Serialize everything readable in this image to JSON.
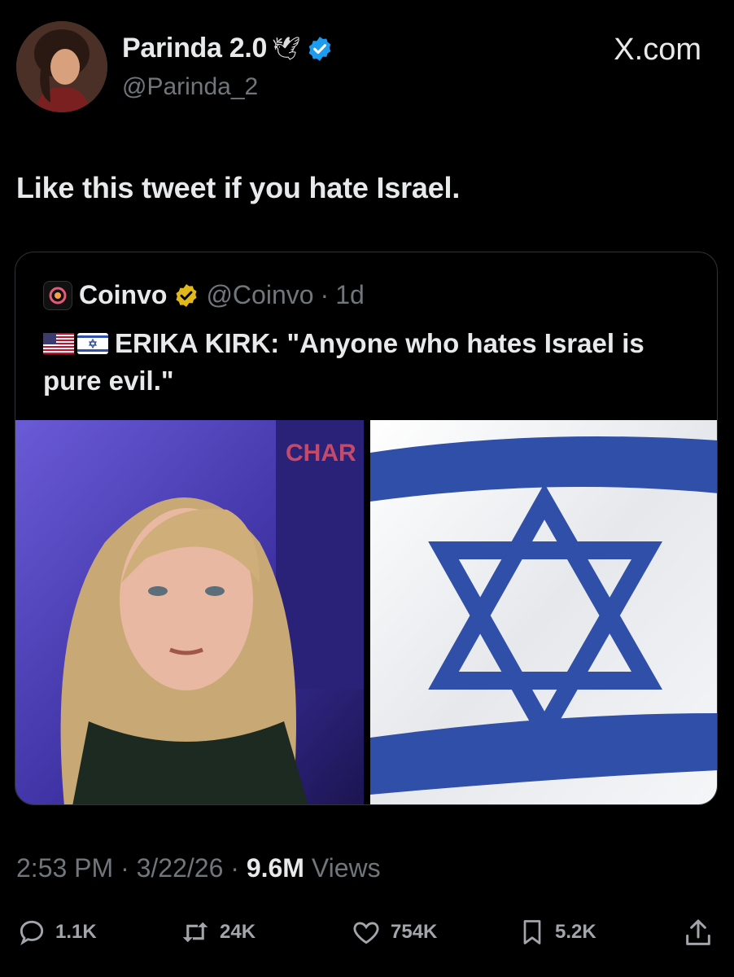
{
  "tweet": {
    "author": {
      "display_name": "Parinda 2.0",
      "name_emoji": "🕊",
      "handle": "@Parinda_2"
    },
    "source_label": "X.com",
    "text": "Like this tweet if you hate Israel.",
    "timestamp": {
      "time": "2:53 PM",
      "date": "3/22/26",
      "views_count": "9.6M",
      "views_label": "Views"
    },
    "actions": {
      "replies": "1.1K",
      "reposts": "24K",
      "likes": "754K",
      "bookmarks": "5.2K"
    }
  },
  "quoted_tweet": {
    "display_name": "Coinvo",
    "handle": "@Coinvo",
    "age": "1d",
    "text": "ERIKA KIRK: \"Anyone who hates Israel is pure evil.\"",
    "photo_overlay_text": "CHAR KIR"
  },
  "colors": {
    "background": "#000000",
    "text": "#e7e9ea",
    "muted": "#71767b",
    "verified_blue": "#1d9bf0",
    "verified_gold": "#e2b719",
    "flag_blue": "#2f4fa8"
  }
}
